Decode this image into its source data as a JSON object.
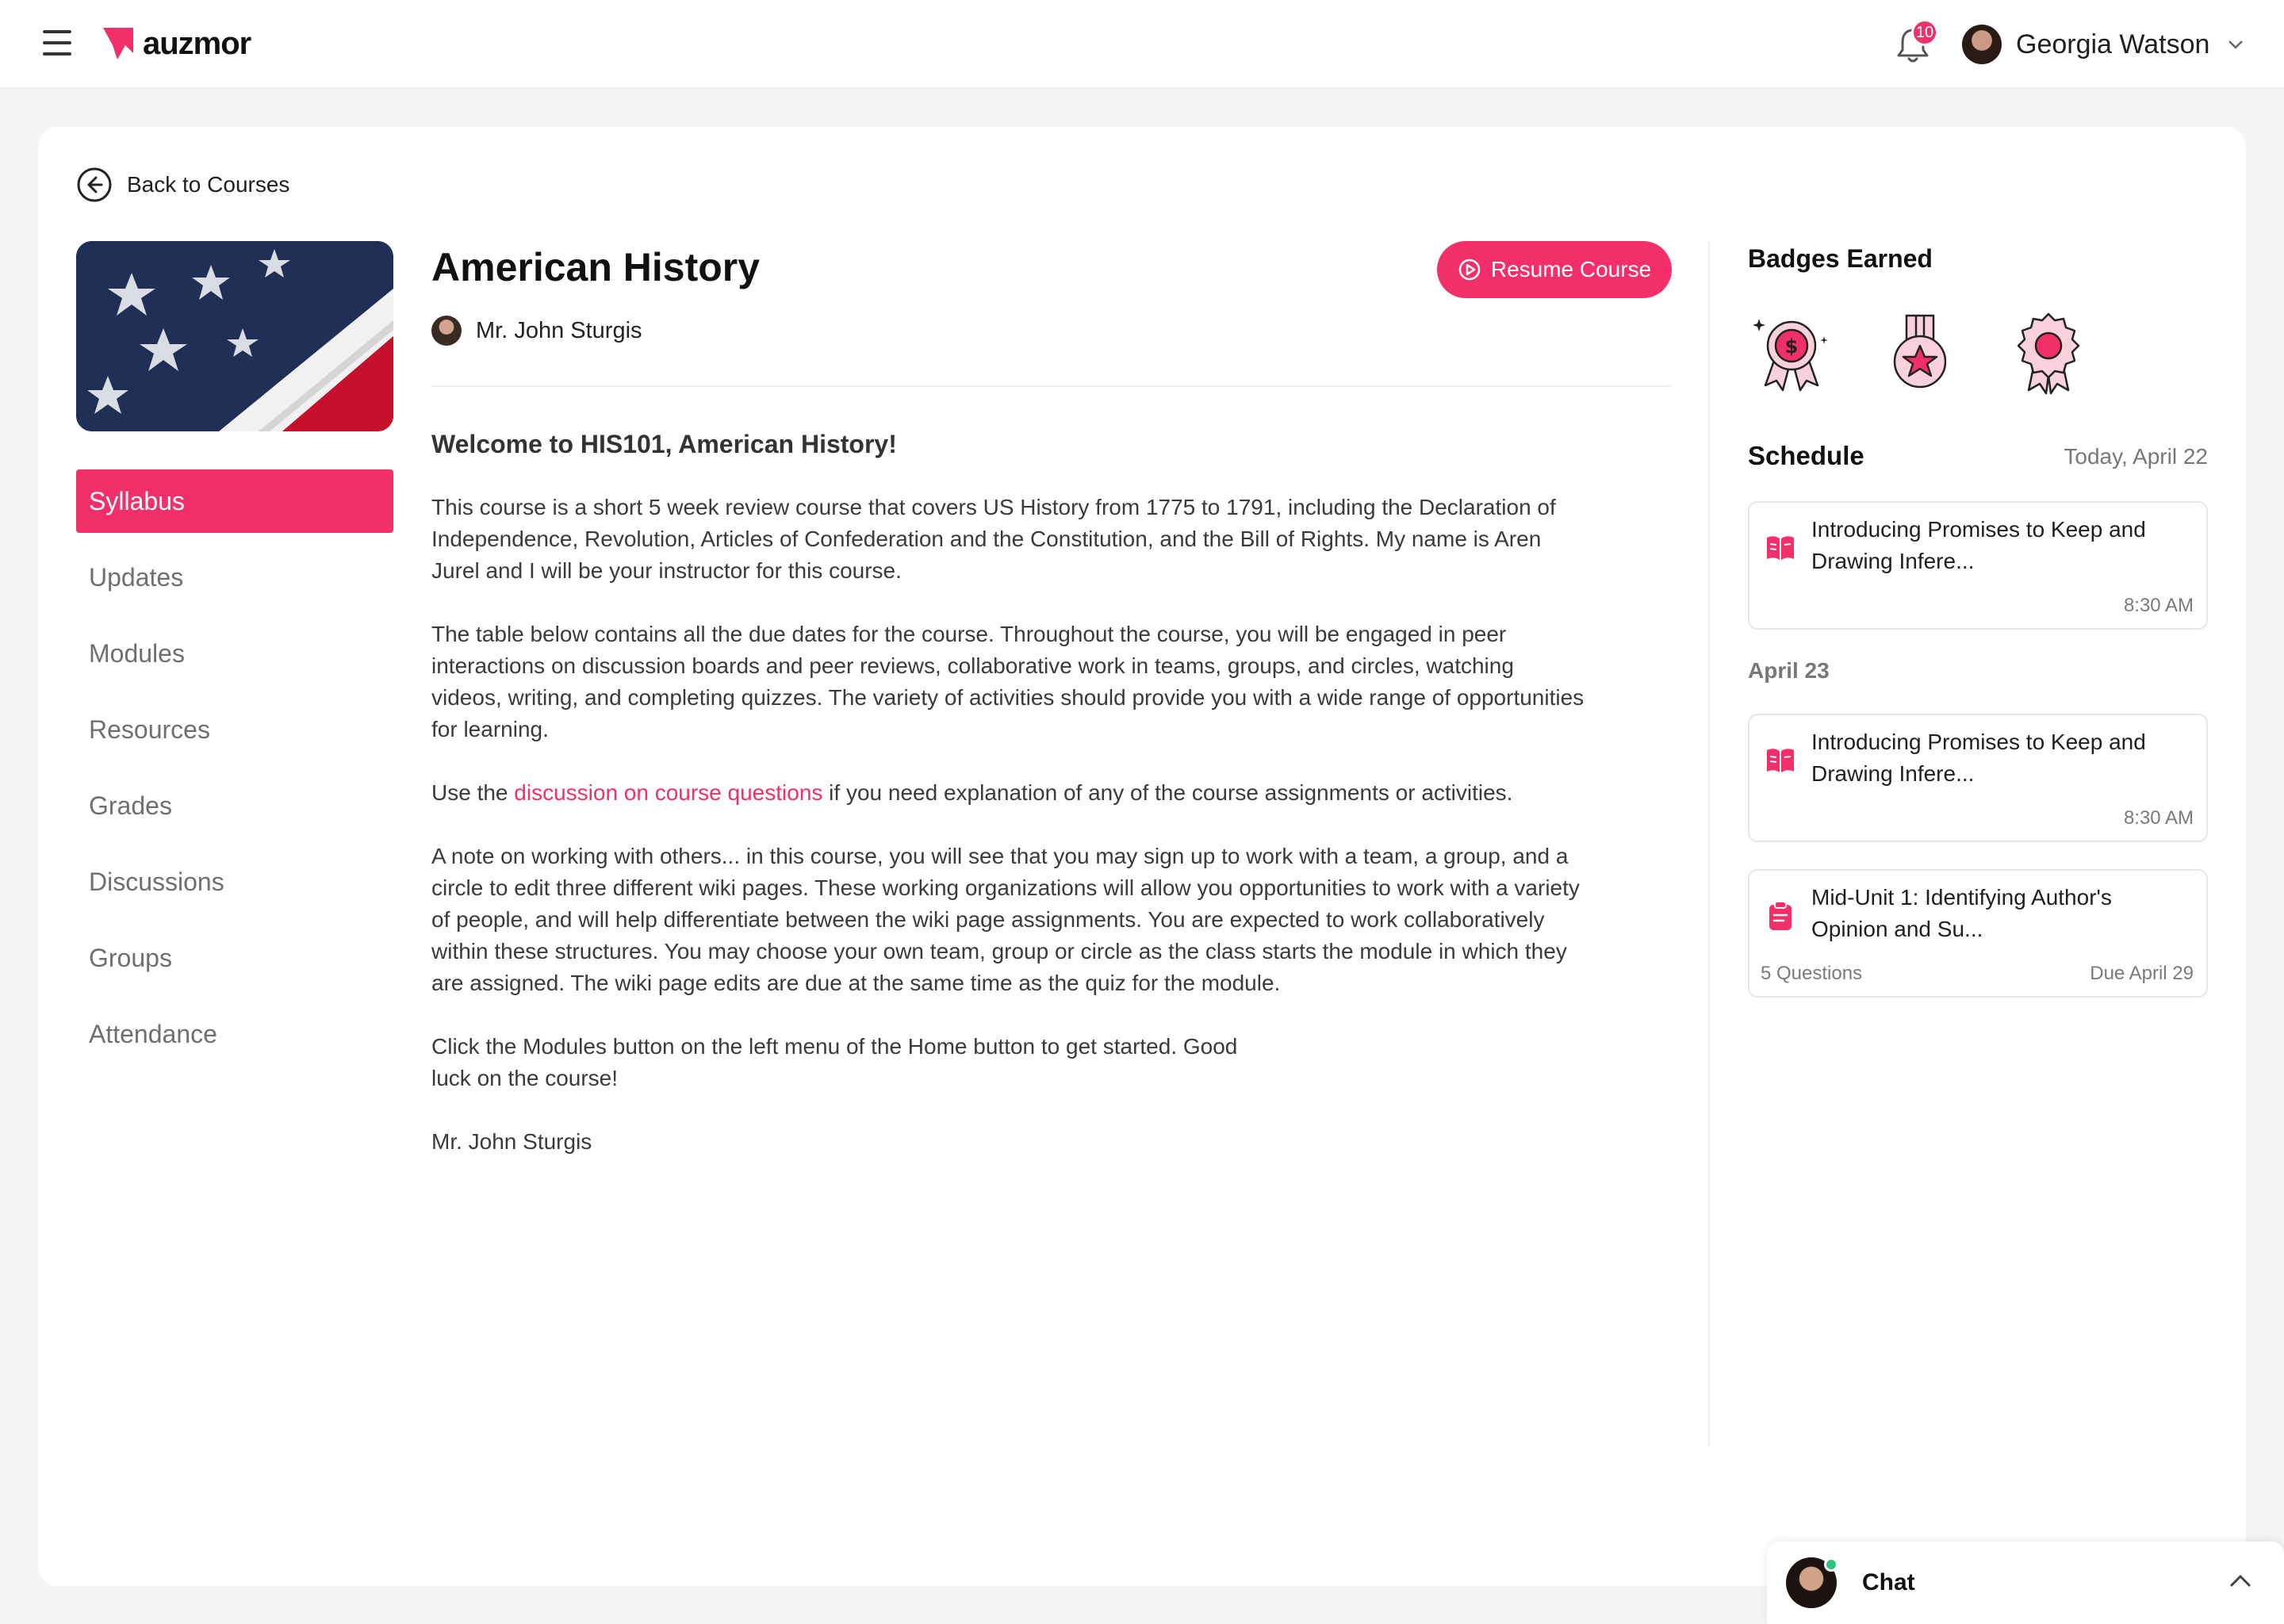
{
  "header": {
    "brand": "auzmor",
    "notifications_count": "10",
    "user_name": "Georgia Watson"
  },
  "back_label": "Back to Courses",
  "course": {
    "title": "American History",
    "instructor": "Mr. John Sturgis",
    "resume_label": "Resume Course"
  },
  "nav": {
    "items": [
      "Syllabus",
      "Updates",
      "Modules",
      "Resources",
      "Grades",
      "Discussions",
      "Groups",
      "Attendance"
    ],
    "active": "Syllabus"
  },
  "syllabus": {
    "heading": "Welcome to HIS101, American History!",
    "p1": "This course is a short 5 week review course that covers US History from 1775 to 1791, including the Declaration of Independence, Revolution, Articles of Confederation and the Constitution, and the Bill of Rights. My name is Aren Jurel and I will be your instructor for this course.",
    "p2": "The table below contains all the due dates for the course. Throughout the course, you will be engaged in peer interactions on discussion boards and peer reviews, collaborative work in teams, groups, and circles, watching videos, writing, and completing quizzes. The variety of activities should provide you with a wide range of opportunities for learning.",
    "p3_before": "Use the ",
    "p3_link": "discussion on course questions",
    "p3_after": " if you need explanation of any of the course assignments or activities.",
    "p4": "A note on working with others... in this course, you will see that you may sign up to work with a team, a group, and a circle to edit three different wiki pages. These working organizations will allow you opportunities to work with a variety of people, and will help differentiate between the wiki page assignments. You are expected to work collaboratively within these structures. You may choose your own team, group or circle as the class starts the module in which they are assigned. The wiki page edits are due at the same time as the quiz for the module.",
    "p5": "Click the Modules button on the left menu of the Home button to get started. Good luck on the course!",
    "signature": "Mr. John Sturgis"
  },
  "badges": {
    "title": "Badges Earned",
    "icons": [
      "dollar-ribbon-badge-icon",
      "star-medal-badge-icon",
      "rosette-badge-icon"
    ]
  },
  "schedule": {
    "title": "Schedule",
    "today_label": "Today, April 22",
    "next_day_label": "April 23",
    "events": [
      {
        "title": "Introducing Promises to Keep and Drawing Infere...",
        "time": "8:30 AM",
        "icon": "book-icon"
      },
      {
        "title": "Introducing Promises to Keep and Drawing Infere...",
        "time": "8:30 AM",
        "icon": "book-icon"
      },
      {
        "title": "Mid-Unit 1: Identifying Author's Opinion and Su...",
        "meta": "5 Questions",
        "due": "Due April 29",
        "icon": "clipboard-icon"
      }
    ]
  },
  "chat": {
    "label": "Chat"
  },
  "colors": {
    "accent": "#f22f68",
    "online": "#2ec27e"
  }
}
